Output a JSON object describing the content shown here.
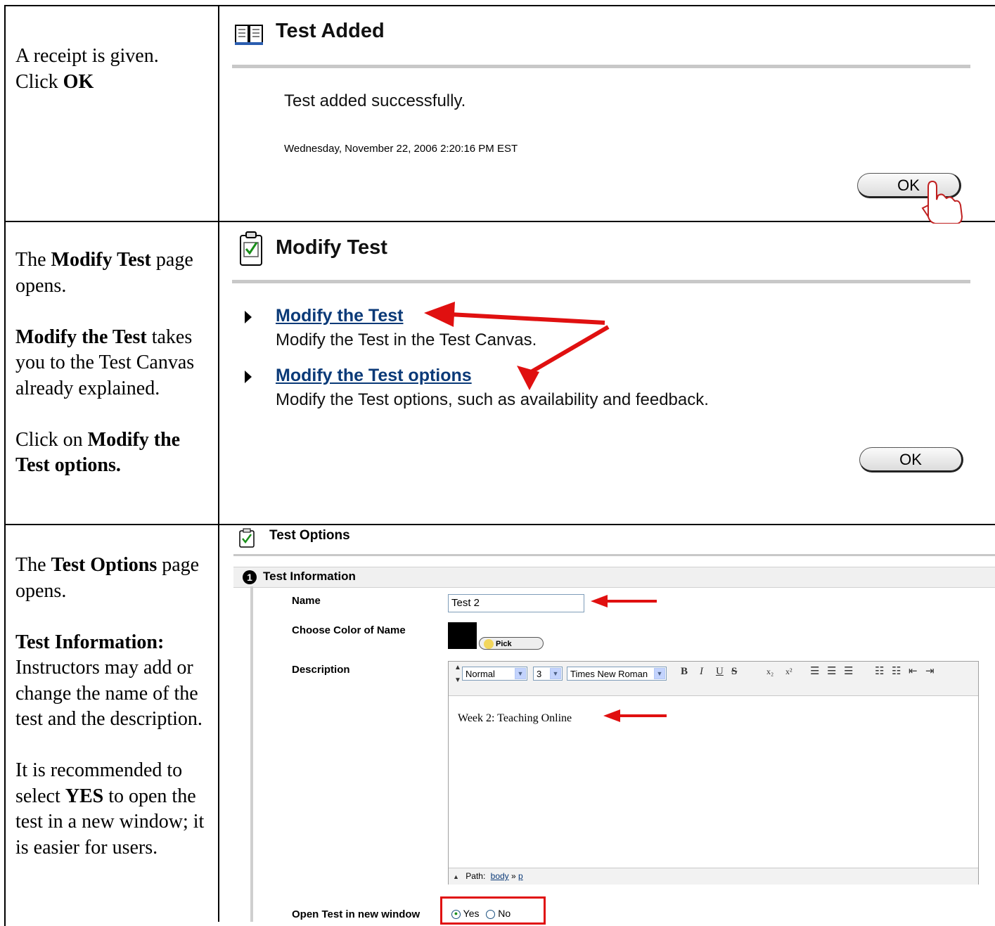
{
  "rows": {
    "r1": {
      "p1": "A receipt is given.",
      "p1b_prefix": "Click ",
      "p1b_bold": "OK"
    },
    "r2": {
      "a_prefix": "The ",
      "a_bold": "Modify Test",
      "a_suffix": " page opens.",
      "b_bold": "Modify the Test",
      "b_suffix": " takes you to the Test Canvas already explained.",
      "c_prefix": "Click on ",
      "c_bold": "Modify the Test options."
    },
    "r3": {
      "a_prefix": "The ",
      "a_bold": "Test Options",
      "a_suffix": " page opens.",
      "b_bold": "Test Information:",
      "b_suffix": " Instructors may add or change the name of the test and the description.",
      "c_prefix": "It is recommended to select ",
      "c_bold": "YES",
      "c_suffix": " to open the test in a new window; it is easier for users."
    }
  },
  "test_added": {
    "title": "Test Added",
    "message": "Test added successfully.",
    "timestamp": "Wednesday, November 22, 2006 2:20:16 PM EST",
    "ok_label": "OK"
  },
  "modify_test": {
    "title": "Modify Test",
    "link1": "Modify the Test",
    "desc1": "Modify the Test in the Test Canvas.",
    "link2": "Modify the Test options",
    "desc2": "Modify the Test options, such as availability and feedback.",
    "ok_label": "OK"
  },
  "test_options": {
    "title": "Test Options",
    "step_number": "1",
    "section": "Test Information",
    "name_label": "Name",
    "name_value": "Test 2",
    "color_label": "Choose Color of Name",
    "pick_label": "Pick",
    "description_label": "Description",
    "editor": {
      "style": "Normal",
      "size": "3",
      "font": "Times New Roman",
      "content": "Week 2: Teaching Online",
      "path_label": "Path:",
      "path_body": "body",
      "path_sep": "»",
      "path_p": "p"
    },
    "open_new_window_label": "Open Test in new window",
    "yes_label": "Yes",
    "no_label": "No"
  },
  "colors": {
    "arrow": "#e01010",
    "link": "#0b3a78",
    "highlight_box": "#e01010",
    "name_color": "#000000"
  }
}
